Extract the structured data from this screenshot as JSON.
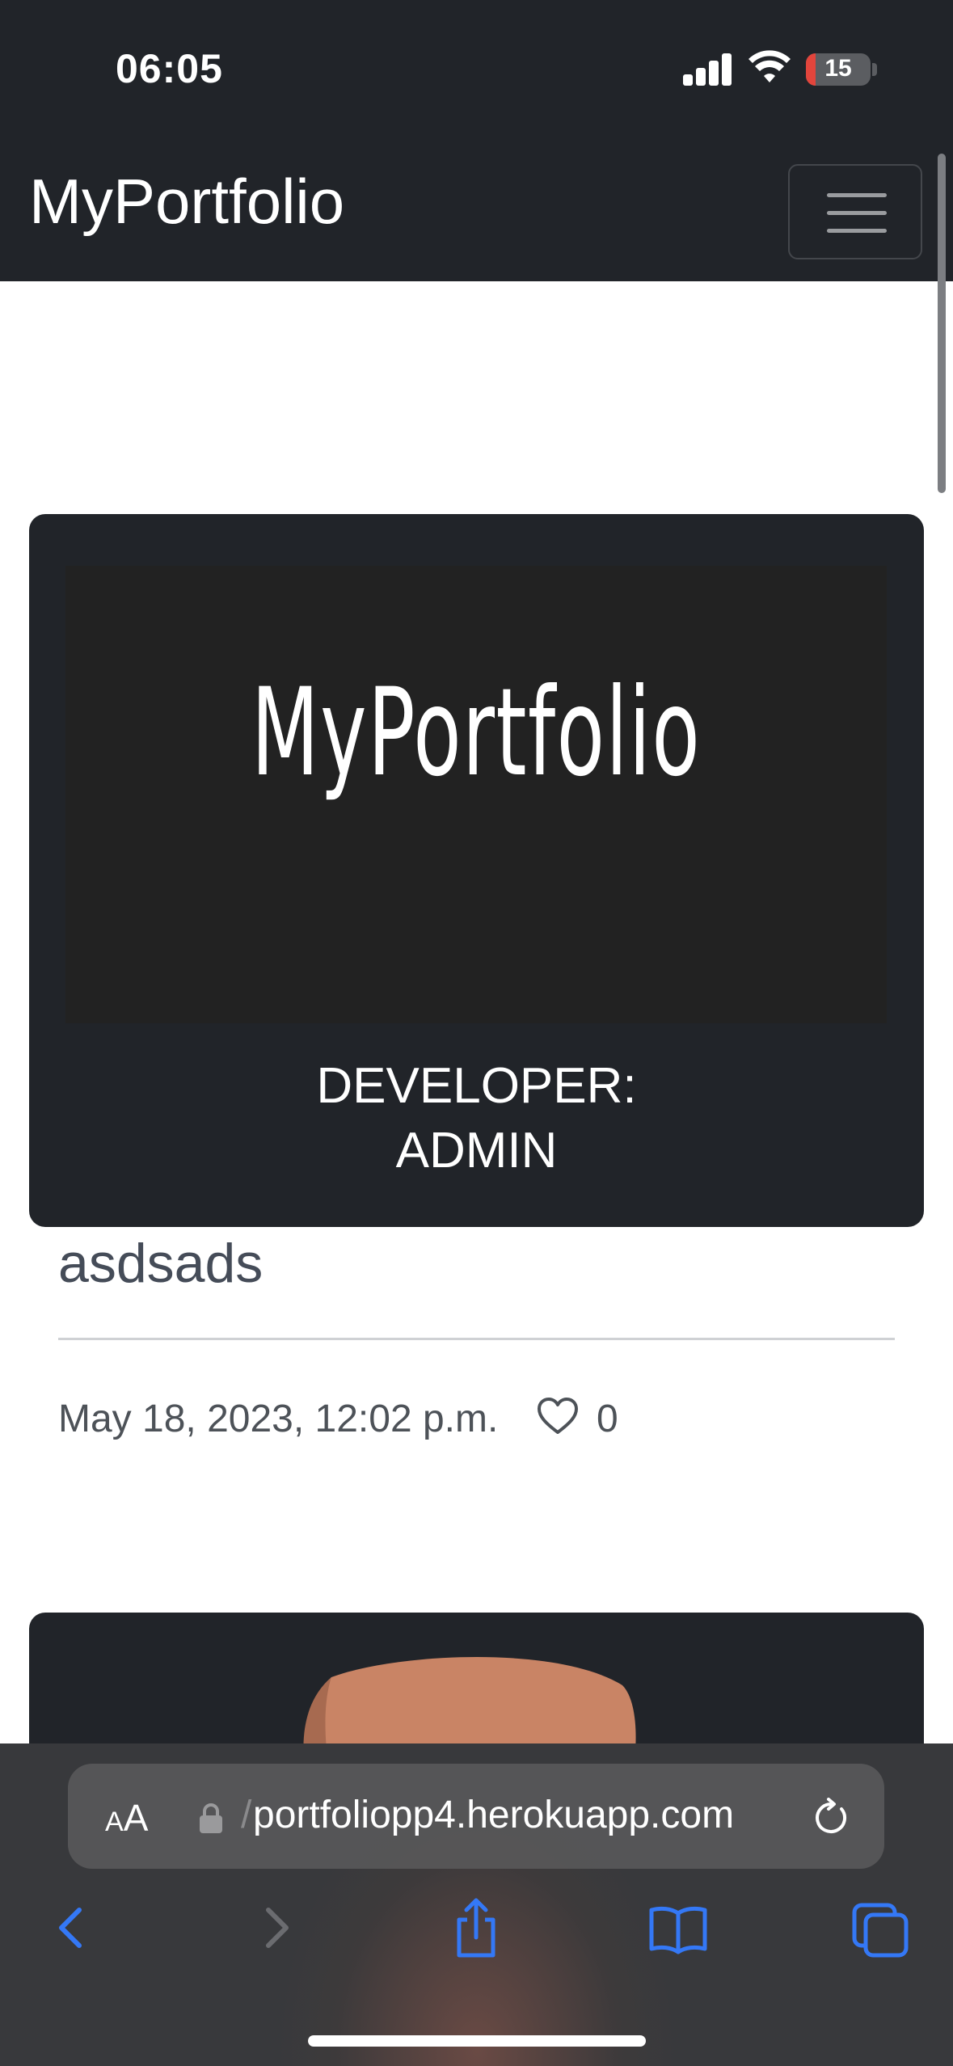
{
  "status_bar": {
    "time": "06:05",
    "battery_level": "15",
    "icons": [
      "signal-icon",
      "wifi-icon",
      "battery-icon"
    ]
  },
  "navbar": {
    "brand": "MyPortfolio",
    "toggler_icon": "hamburger-icon"
  },
  "posts": [
    {
      "image_text": "MyPortfolio",
      "caption_line1": "DEVELOPER:",
      "caption_line2": "ADMIN",
      "title": "asdsads",
      "date": "May 18, 2023, 12:02 p.m.",
      "likes": "0",
      "like_icon": "heart-icon"
    }
  ],
  "browser": {
    "text_size_small": "A",
    "text_size_big": "A",
    "url_prefix": "/",
    "url": "portfoliopp4.herokuapp.com",
    "icons": [
      "lock-icon",
      "reload-icon",
      "back-icon",
      "forward-icon",
      "share-icon",
      "bookmarks-icon",
      "tabs-icon"
    ]
  },
  "colors": {
    "navbar_bg": "#212429",
    "card_bg": "#212429",
    "title_text": "#454c58",
    "safari_accent": "#3478f6"
  }
}
